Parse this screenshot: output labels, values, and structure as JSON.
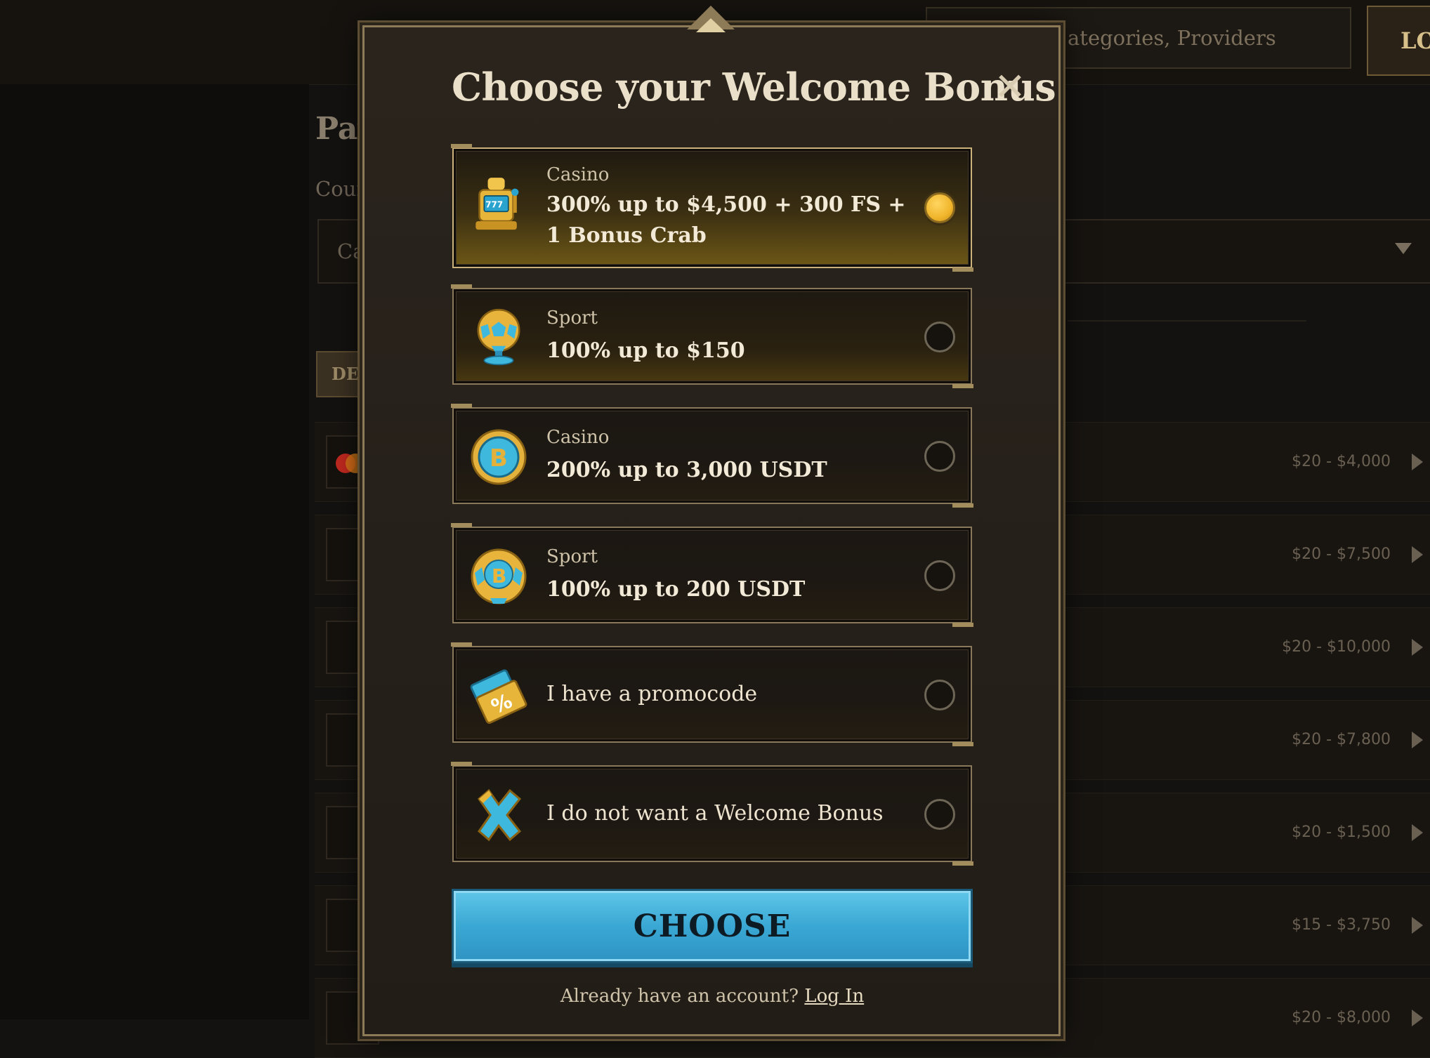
{
  "background": {
    "search_text": "ategories, Providers",
    "login_label": "LO",
    "title": "Pay",
    "country_label": "Cour",
    "country_value": "Ca",
    "deposit_tab": "DEI",
    "methods": [
      {
        "range": "$20 - $4,000"
      },
      {
        "range": "$20 - $7,500"
      },
      {
        "range": "$20 - $10,000"
      },
      {
        "range": "$20 - $7,800"
      },
      {
        "range": "$20 - $1,500"
      },
      {
        "range": "$15 - $3,750"
      },
      {
        "range": "$20 - $8,000"
      }
    ]
  },
  "modal": {
    "title": "Choose your Welcome Bonus",
    "close_label": "✕",
    "options": [
      {
        "category": "Casino",
        "offer": "300% up to $4,500 + 300 FS + 1 Bonus Crab",
        "icon": "slot-machine-icon",
        "selected": true
      },
      {
        "category": "Sport",
        "offer": "100% up to $150",
        "icon": "soccer-trophy-icon",
        "selected": false
      },
      {
        "category": "Casino",
        "offer": "200% up to 3,000 USDT",
        "icon": "bitcoin-coin-icon",
        "selected": false
      },
      {
        "category": "Sport",
        "offer": "100% up to 200 USDT",
        "icon": "bitcoin-ball-icon",
        "selected": false
      },
      {
        "label": "I have a promocode",
        "icon": "promo-tickets-icon",
        "selected": false
      },
      {
        "label": "I do not want a Welcome Bonus",
        "icon": "cross-icon",
        "selected": false
      }
    ],
    "choose_label": "CHOOSE",
    "already_text": "Already have an account?",
    "login_link": "Log In"
  },
  "colors": {
    "accent_gold": "#f0b52b",
    "button_blue": "#3aa8d4",
    "frame_gold": "#8d7a56"
  }
}
